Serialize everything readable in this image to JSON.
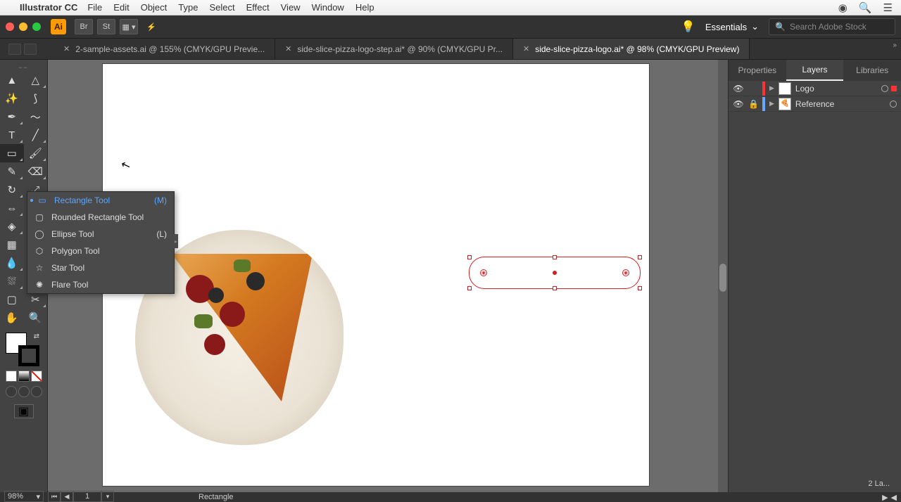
{
  "menubar": {
    "appname": "Illustrator CC",
    "items": [
      "File",
      "Edit",
      "Object",
      "Type",
      "Select",
      "Effect",
      "View",
      "Window",
      "Help"
    ]
  },
  "appbar": {
    "workspace": "Essentials",
    "search_placeholder": "Search Adobe Stock"
  },
  "tabs": [
    "2-sample-assets.ai @ 155% (CMYK/GPU Previe...",
    "side-slice-pizza-logo-step.ai* @ 90% (CMYK/GPU Pr...",
    "side-slice-pizza-logo.ai* @ 98% (CMYK/GPU Preview)"
  ],
  "active_tab": 2,
  "flyout": {
    "items": [
      {
        "label": "Rectangle Tool",
        "shortcut": "(M)",
        "glyph": "▭",
        "selected": true
      },
      {
        "label": "Rounded Rectangle Tool",
        "shortcut": "",
        "glyph": "▢",
        "selected": false
      },
      {
        "label": "Ellipse Tool",
        "shortcut": "(L)",
        "glyph": "◯",
        "selected": false
      },
      {
        "label": "Polygon Tool",
        "shortcut": "",
        "glyph": "⬡",
        "selected": false
      },
      {
        "label": "Star Tool",
        "shortcut": "",
        "glyph": "☆",
        "selected": false
      },
      {
        "label": "Flare Tool",
        "shortcut": "",
        "glyph": "✺",
        "selected": false
      }
    ]
  },
  "panels": {
    "tabs": [
      "Properties",
      "Layers",
      "Libraries"
    ],
    "active": 1,
    "layers": [
      {
        "name": "Logo",
        "edge": "#ff3333",
        "selected": true,
        "locked": false,
        "thumb": ""
      },
      {
        "name": "Reference",
        "edge": "#66aaff",
        "selected": false,
        "locked": true,
        "thumb": "🍕"
      }
    ],
    "footer": "2 La..."
  },
  "status": {
    "zoom": "98%",
    "artboard": "1",
    "tool": "Rectangle"
  },
  "colors": {
    "accent": "#5aa7ff",
    "selection": "#c22"
  }
}
